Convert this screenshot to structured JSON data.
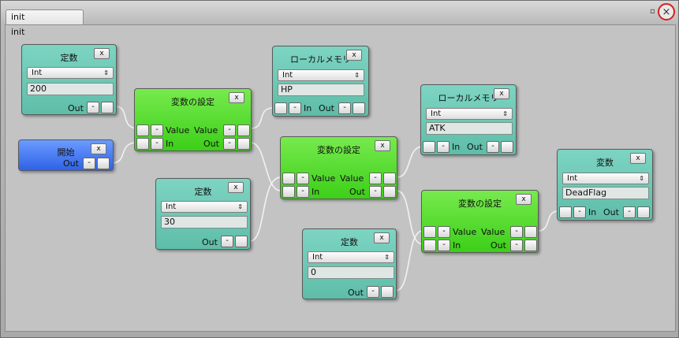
{
  "window": {
    "tab_label": "init",
    "canvas_title": "init",
    "restore_glyph": "▫",
    "close_glyph": "×"
  },
  "labels": {
    "out": "Out",
    "in": "In",
    "value": "Value",
    "x": "x",
    "minus": "-"
  },
  "nodes": {
    "const_a": {
      "title": "定数",
      "type": "Int",
      "value": "200"
    },
    "start": {
      "title": "開始"
    },
    "setvar_a": {
      "title": "変数の設定"
    },
    "local_a": {
      "title": "ローカルメモリ",
      "type": "Int",
      "value": "HP"
    },
    "const_b": {
      "title": "定数",
      "type": "Int",
      "value": "30"
    },
    "setvar_b": {
      "title": "変数の設定"
    },
    "local_b": {
      "title": "ローカルメモリ",
      "type": "Int",
      "value": "ATK"
    },
    "const_c": {
      "title": "定数",
      "type": "Int",
      "value": "0"
    },
    "setvar_c": {
      "title": "変数の設定"
    },
    "var_a": {
      "title": "変数",
      "type": "Int",
      "value": "DeadFlag"
    }
  },
  "colors": {
    "const_node": "#6ccab5",
    "set_node": "#4ad81f",
    "start_node": "#3d6fee",
    "close_ring": "#d62020",
    "wire": "#f2f2f2"
  }
}
